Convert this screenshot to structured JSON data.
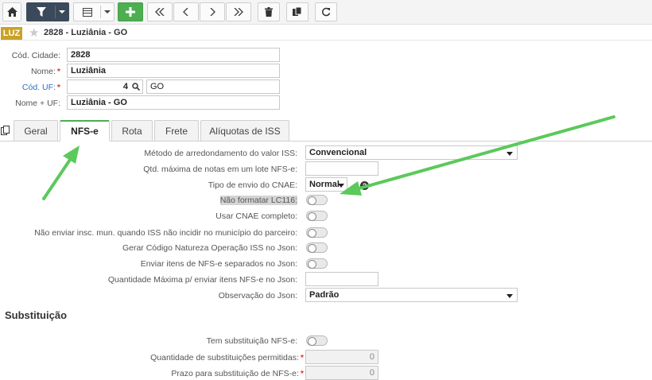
{
  "record": {
    "badge": "LUZ",
    "title": "2828 - Luziânia - GO"
  },
  "fields": {
    "cod_cidade": {
      "label": "Cód. Cidade:",
      "value": "2828"
    },
    "nome": {
      "label": "Nome:",
      "value": "Luziânia"
    },
    "cod_uf": {
      "label": "Cód. UF:",
      "value": "4",
      "uf_name": "GO"
    },
    "nome_uf": {
      "label": "Nome + UF:",
      "value": "Luziânia - GO"
    }
  },
  "tabs": [
    {
      "label": "Geral"
    },
    {
      "label": "NFS-e"
    },
    {
      "label": "Rota"
    },
    {
      "label": "Frete"
    },
    {
      "label": "Alíquotas de ISS"
    }
  ],
  "nfse": {
    "metodo": {
      "label": "Método de arredondamento do valor ISS:",
      "value": "Convencional"
    },
    "qtd_max_notas": {
      "label": "Qtd. máxima de notas em um lote NFS-e:",
      "value": ""
    },
    "tipo_envio": {
      "label": "Tipo de envio do CNAE:",
      "value": "Normal"
    },
    "nao_formatar": {
      "label": "Não formatar LC116:"
    },
    "usar_cnae": {
      "label": "Usar CNAE completo:"
    },
    "nao_enviar_insc": {
      "label": "Não enviar insc. mun. quando ISS não incidir no município do parceiro:"
    },
    "gerar_codigo": {
      "label": "Gerar Código Natureza Operação ISS no Json:"
    },
    "enviar_itens": {
      "label": "Enviar itens de NFS-e separados no Json:"
    },
    "qtd_max_itens": {
      "label": "Quantidade Máxima p/ enviar itens NFS-e no Json:",
      "value": ""
    },
    "observacao": {
      "label": "Observação do Json:",
      "value": "Padrão"
    }
  },
  "substituicao": {
    "title": "Substituição",
    "tem": {
      "label": "Tem substituição NFS-e:"
    },
    "qtd": {
      "label": "Quantidade de substituições permitidas:",
      "value": "0"
    },
    "prazo": {
      "label": "Prazo para substituição de NFS-e:",
      "value": "0"
    }
  },
  "colors": {
    "accent": "#4caf50",
    "badge": "#c9a227",
    "toolbar_dark": "#3b4a5a",
    "required": "#e0302f"
  }
}
